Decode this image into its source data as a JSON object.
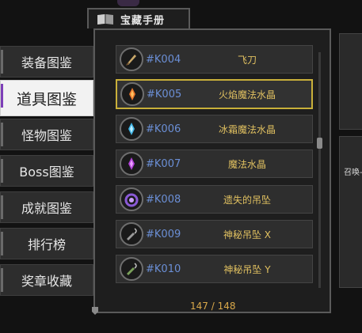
{
  "header": {
    "title": "宝藏手册"
  },
  "sidebar": {
    "items": [
      {
        "label": "装备图鉴"
      },
      {
        "label": "道具图鉴"
      },
      {
        "label": "怪物图鉴"
      },
      {
        "label": "Boss图鉴"
      },
      {
        "label": "成就图鉴"
      },
      {
        "label": "排行榜"
      },
      {
        "label": "奖章收藏"
      }
    ],
    "active_index": 1
  },
  "items": [
    {
      "code": "#K004",
      "name": "飞刀",
      "icon": "throwing-knife-icon",
      "color": "#c9a86a"
    },
    {
      "code": "#K005",
      "name": "火焰魔法水晶",
      "icon": "fire-crystal-icon",
      "color": "#e8742a"
    },
    {
      "code": "#K006",
      "name": "冰霜魔法水晶",
      "icon": "frost-crystal-icon",
      "color": "#3fb6e8"
    },
    {
      "code": "#K007",
      "name": "魔法水晶",
      "icon": "magic-crystal-icon",
      "color": "#b03fd6"
    },
    {
      "code": "#K008",
      "name": "遗失的吊坠",
      "icon": "lost-pendant-icon",
      "color": "#8a5ad6"
    },
    {
      "code": "#K009",
      "name": "神秘吊坠 X",
      "icon": "mystery-pendant-x-icon",
      "color": "#9a9a9a"
    },
    {
      "code": "#K010",
      "name": "神秘吊坠 Y",
      "icon": "mystery-pendant-y-icon",
      "color": "#7aa05a"
    }
  ],
  "selected_index": 1,
  "pagination": {
    "text": "147 / 148"
  },
  "right_panel": {
    "label": "召唤-"
  },
  "colors": {
    "accent_gold": "#c9b03a",
    "code_blue": "#6b8fd6",
    "name_gold": "#e0c060",
    "active_purple": "#7d3fb8"
  }
}
